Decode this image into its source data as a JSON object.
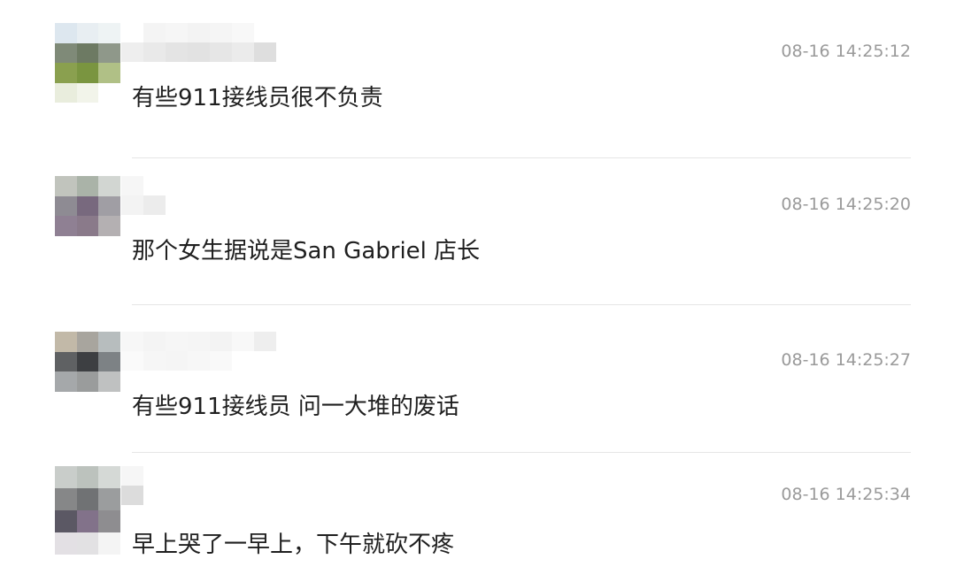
{
  "comments": [
    {
      "timestamp": "08-16 14:25:12",
      "text": "有些911接线员很不负责"
    },
    {
      "timestamp": "08-16 14:25:20",
      "text": "那个女生据说是San Gabriel 店长"
    },
    {
      "timestamp": "08-16 14:25:27",
      "text": "有些911接线员 问一大堆的废话"
    },
    {
      "timestamp": "08-16 14:25:34",
      "text": "早上哭了一早上，下午就砍不疼"
    }
  ]
}
